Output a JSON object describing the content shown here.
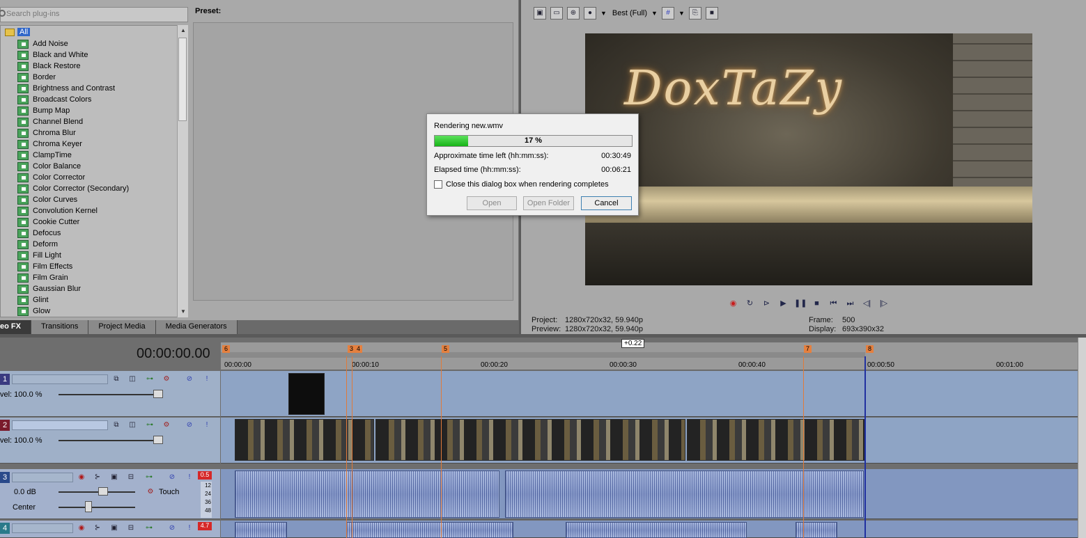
{
  "plugin_chooser": {
    "search_placeholder": "Search plug-ins",
    "root_label": "All",
    "items": [
      "Add Noise",
      "Black and White",
      "Black Restore",
      "Border",
      "Brightness and Contrast",
      "Broadcast Colors",
      "Bump Map",
      "Channel Blend",
      "Chroma Blur",
      "Chroma Keyer",
      "ClampTime",
      "Color Balance",
      "Color Corrector",
      "Color Corrector (Secondary)",
      "Color Curves",
      "Convolution Kernel",
      "Cookie Cutter",
      "Defocus",
      "Deform",
      "Fill Light",
      "Film Effects",
      "Film Grain",
      "Gaussian Blur",
      "Glint",
      "Glow"
    ],
    "preset_label": "Preset:"
  },
  "window_tabs": [
    "eo FX",
    "Transitions",
    "Project Media",
    "Media Generators"
  ],
  "preview": {
    "quality": "Best (Full)",
    "overlay_text": "DoxTaZy",
    "info": {
      "project_key": "Project:",
      "project_val": "1280x720x32, 59.940p",
      "preview_key": "Preview:",
      "preview_val": "1280x720x32, 59.940p",
      "frame_key": "Frame:",
      "frame_val": "500",
      "display_key": "Display:",
      "display_val": "693x390x32"
    }
  },
  "timeline": {
    "time_counter": "00:00:00.00",
    "region_badge": "+0.22",
    "markers": [
      "6",
      "3",
      "4",
      "5",
      "7",
      "8"
    ],
    "ruler_times": [
      "00:00:00",
      "00:00:10",
      "00:00:20",
      "00:00:30",
      "00:00:40",
      "00:00:50",
      "00:01:00"
    ],
    "tracks": [
      {
        "num": "1",
        "type": "video",
        "level": "vel: 100.0 %"
      },
      {
        "num": "2",
        "type": "video",
        "level": "vel: 100.0 %"
      },
      {
        "num": "3",
        "type": "audio",
        "volume": "0.0 dB",
        "pan": "Center",
        "mode": "Touch",
        "peak": "0.5",
        "meter": [
          "12",
          "24",
          "36",
          "48"
        ]
      },
      {
        "num": "4",
        "type": "audio",
        "peak": "4.7"
      }
    ]
  },
  "render_dialog": {
    "title": "Rendering new.wmv",
    "progress": 17,
    "progress_text": "17 %",
    "time_left_label": "Approximate time left (hh:mm:ss):",
    "time_left": "00:30:49",
    "elapsed_label": "Elapsed time (hh:mm:ss):",
    "elapsed": "00:06:21",
    "close_checkbox_label": "Close this dialog box when rendering completes",
    "open_button": "Open",
    "open_folder_button": "Open Folder",
    "cancel_button": "Cancel"
  },
  "colors": {
    "progress": "#17b317",
    "marker": "#e5803f",
    "selection": "#2f66c9",
    "peak_red": "#d62828"
  }
}
